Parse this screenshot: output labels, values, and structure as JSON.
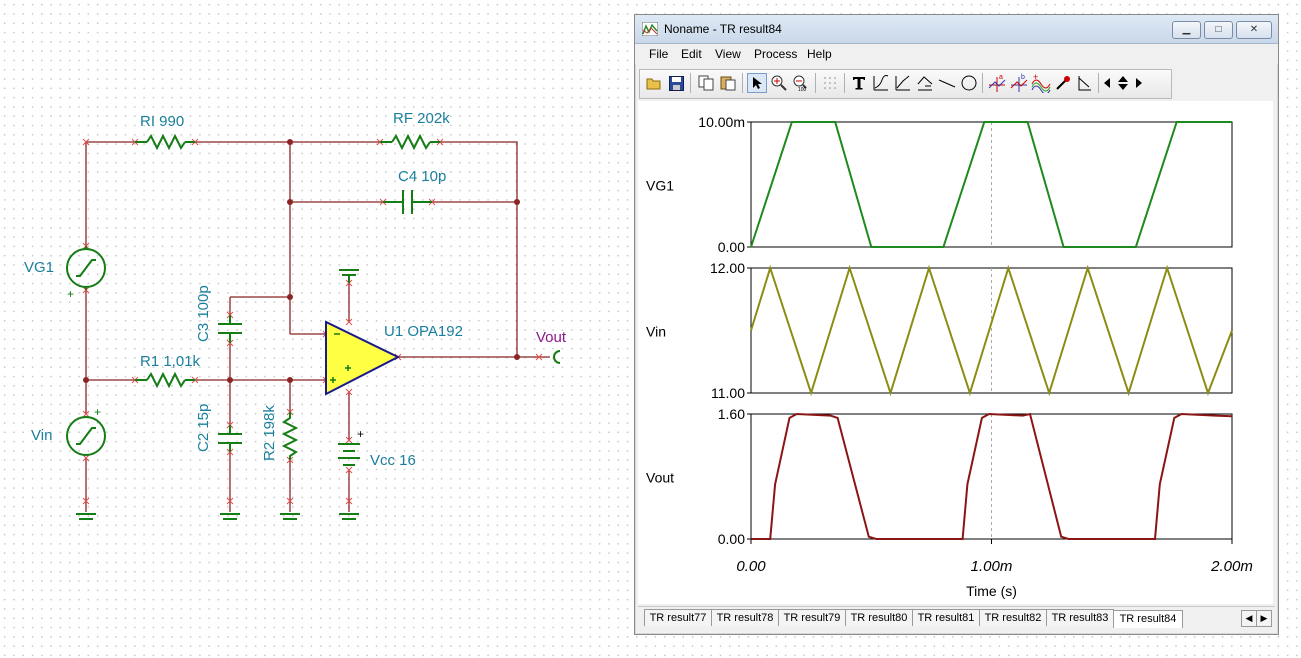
{
  "schematic": {
    "labels": {
      "ri": "RI 990",
      "rf": "RF 202k",
      "c4": "C4 10p",
      "c3": "C3 100p",
      "u1": "U1 OPA192",
      "vout": "Vout",
      "vg1": "VG1",
      "r1": "R1 1,01k",
      "c2": "C2 15p",
      "r2": "R2 198k",
      "vin": "Vin",
      "vcc": "Vcc 16",
      "plus": "+",
      "minus": "-"
    },
    "colors": {
      "wire": "#8b2525",
      "component": "#147d14",
      "opamp_fill": "#ffff44",
      "label": "#1a7f9c"
    }
  },
  "window": {
    "title": "Noname - TR result84",
    "controls": [
      "minimize",
      "maximize",
      "close"
    ],
    "menu": [
      "File",
      "Edit",
      "View",
      "Process",
      "Help"
    ],
    "toolbar_icons": [
      "open-icon",
      "save-icon",
      "copy-icon",
      "paste-icon",
      "pointer-icon",
      "zoom-in-icon",
      "zoom-100-icon",
      "grid-icon",
      "text-icon",
      "curve-icon",
      "curve2-icon",
      "axis-icon",
      "line-icon",
      "circle-icon",
      "cursor-a-icon",
      "cursor-b-icon",
      "waveform-icon",
      "probe-icon",
      "marker-icon",
      "nav-left-icon",
      "nav-updown-icon",
      "nav-right-icon"
    ],
    "tabs": [
      "TR result77",
      "TR result78",
      "TR result79",
      "TR result80",
      "TR result81",
      "TR result82",
      "TR result83",
      "TR result84"
    ],
    "active_tab": "TR result84"
  },
  "chart_data": [
    {
      "type": "line",
      "ylabel": "VG1",
      "color": "#1e8a1e",
      "ylim": [
        0,
        0.01
      ],
      "ytick_labels": [
        "10.00m",
        "0.00"
      ],
      "x": [
        0,
        0.00017,
        0.00035,
        0.0005,
        0.0008,
        0.00097,
        0.00115,
        0.0013,
        0.0016,
        0.00177,
        0.00195,
        0.002
      ],
      "y": [
        0,
        0.01,
        0.01,
        0,
        0,
        0.01,
        0.01,
        0,
        0,
        0.01,
        0.01,
        0.01
      ]
    },
    {
      "type": "line",
      "ylabel": "Vin",
      "color": "#8c8c14",
      "ylim": [
        11,
        12
      ],
      "ytick_labels": [
        "12.00",
        "11.00"
      ],
      "x": [
        0,
        8e-05,
        0.00025,
        0.00041,
        0.00058,
        0.00074,
        0.00091,
        0.00107,
        0.00124,
        0.0014,
        0.00157,
        0.00173,
        0.0019,
        0.002
      ],
      "y": [
        11.5,
        12,
        11,
        12,
        11,
        12,
        11,
        12,
        11,
        12,
        11,
        12,
        11,
        11.5
      ]
    },
    {
      "type": "line",
      "ylabel": "Vout",
      "color": "#8b1515",
      "ylim": [
        0,
        1.6
      ],
      "ytick_labels": [
        "1.60",
        "0.00"
      ],
      "xlim": [
        0,
        0.002
      ],
      "xtick_labels": [
        "0.00",
        "1.00m",
        "2.00m"
      ],
      "xlabel": "Time (s)",
      "x": [
        0,
        8e-05,
        0.0001,
        0.00016,
        0.00019,
        0.00033,
        0.00036,
        0.00049,
        0.00052,
        0.00088,
        0.0009,
        0.00096,
        0.00099,
        0.00113,
        0.00116,
        0.00129,
        0.00132,
        0.00168,
        0.0017,
        0.00176,
        0.00179,
        0.00193,
        0.002
      ],
      "y": [
        0,
        0,
        0.7,
        1.55,
        1.6,
        1.58,
        1.55,
        0.03,
        0,
        0,
        0.7,
        1.55,
        1.6,
        1.58,
        1.6,
        0.03,
        0,
        0,
        0.7,
        1.55,
        1.6,
        1.58,
        1.57
      ]
    }
  ]
}
